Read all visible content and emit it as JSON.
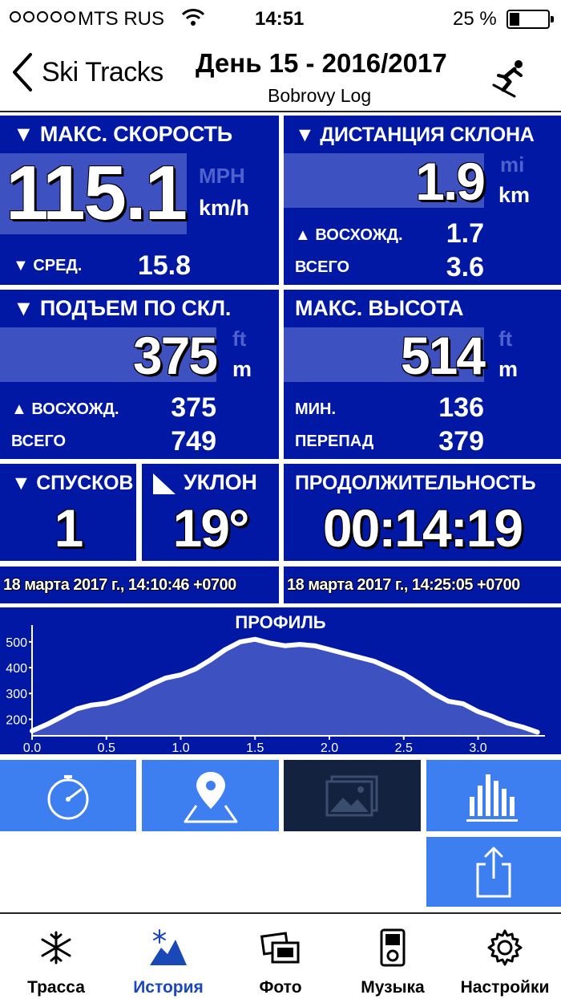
{
  "status_bar": {
    "carrier": "MTS RUS",
    "time": "14:51",
    "battery_percent": "25 %",
    "battery_level": 0.25
  },
  "navbar": {
    "back_label": "Ski Tracks",
    "title": "День 15 - 2016/2017",
    "subtitle": "Bobrovy Log"
  },
  "tiles": {
    "max_speed": {
      "header": "▼ МАКС. СКОРОСТЬ",
      "value": "115.1",
      "unit_alt": "MPH",
      "unit": "km/h",
      "avg_label": "▼ СРЕД.",
      "avg_value": "15.8"
    },
    "slope_distance": {
      "header": "▼ ДИСТАНЦИЯ СКЛОНА",
      "value": "1.9",
      "unit_alt": "mi",
      "unit": "km",
      "ascent_label": "▲ ВОСХОЖД.",
      "ascent_value": "1.7",
      "total_label": "ВСЕГО",
      "total_value": "3.6"
    },
    "vertical": {
      "header": "▼ ПОДЪЕМ ПО СКЛ.",
      "value": "375",
      "unit_alt": "ft",
      "unit": "m",
      "ascent_label": "▲ ВОСХОЖД.",
      "ascent_value": "375",
      "total_label": "ВСЕГО",
      "total_value": "749"
    },
    "max_altitude": {
      "header": "МАКС. ВЫСОТА",
      "value": "514",
      "unit_alt": "ft",
      "unit": "m",
      "min_label": "МИН.",
      "min_value": "136",
      "range_label": "ПЕРЕПАД",
      "range_value": "379"
    },
    "runs": {
      "header": "▼ СПУСКОВ",
      "value": "1"
    },
    "slope": {
      "header": "УКЛОН",
      "value": "19°"
    },
    "duration": {
      "header": "ПРОДОЛЖИТЕЛЬНОСТЬ",
      "value": "00:14:19"
    }
  },
  "dates": {
    "start": "18 марта 2017 г., 14:10:46 +0700",
    "end": "18 марта 2017 г., 14:25:05 +0700"
  },
  "chart_data": {
    "type": "area",
    "title": "ПРОФИЛЬ",
    "xlabel": "",
    "ylabel": "",
    "xlim": [
      0,
      3.45
    ],
    "ylim": [
      136,
      540
    ],
    "x_ticks": [
      "0.0",
      "0.5",
      "1.0",
      "1.5",
      "2.0",
      "2.5",
      "3.0"
    ],
    "y_ticks": [
      "500",
      "400",
      "300",
      "200"
    ],
    "series": [
      {
        "x": [
          0.0,
          0.1,
          0.2,
          0.3,
          0.4,
          0.5,
          0.6,
          0.7,
          0.8,
          0.9,
          1.0,
          1.1,
          1.2,
          1.3,
          1.4,
          1.5,
          1.6,
          1.7,
          1.8,
          1.9,
          2.0,
          2.1,
          2.2,
          2.3,
          2.4,
          2.5,
          2.6,
          2.7,
          2.8,
          2.9,
          3.0,
          3.1,
          3.2,
          3.3,
          3.4
        ],
        "y": [
          155,
          180,
          210,
          240,
          255,
          262,
          280,
          305,
          335,
          360,
          372,
          395,
          430,
          470,
          500,
          510,
          495,
          485,
          490,
          485,
          470,
          455,
          440,
          425,
          400,
          375,
          340,
          300,
          270,
          260,
          230,
          210,
          185,
          170,
          150
        ]
      }
    ],
    "grid": false,
    "legend": "none"
  },
  "buttons": {
    "stopwatch": "stopwatch-icon",
    "map": "map-pin-icon",
    "photos": "photo-icon",
    "stats": "bar-chart-icon",
    "share": "share-icon"
  },
  "tabs": [
    {
      "label": "Трасса",
      "icon": "snowflake-icon"
    },
    {
      "label": "История",
      "icon": "mountain-history-icon"
    },
    {
      "label": "Фото",
      "icon": "photos-icon"
    },
    {
      "label": "Музыка",
      "icon": "music-player-icon"
    },
    {
      "label": "Настройки",
      "icon": "gear-icon"
    }
  ],
  "colors": {
    "tile_bg": "#0018a4",
    "band": "#3d51c0",
    "button_light": "#3d7ef1",
    "button_dark": "#12223f",
    "active_tab": "#1a48b7"
  }
}
